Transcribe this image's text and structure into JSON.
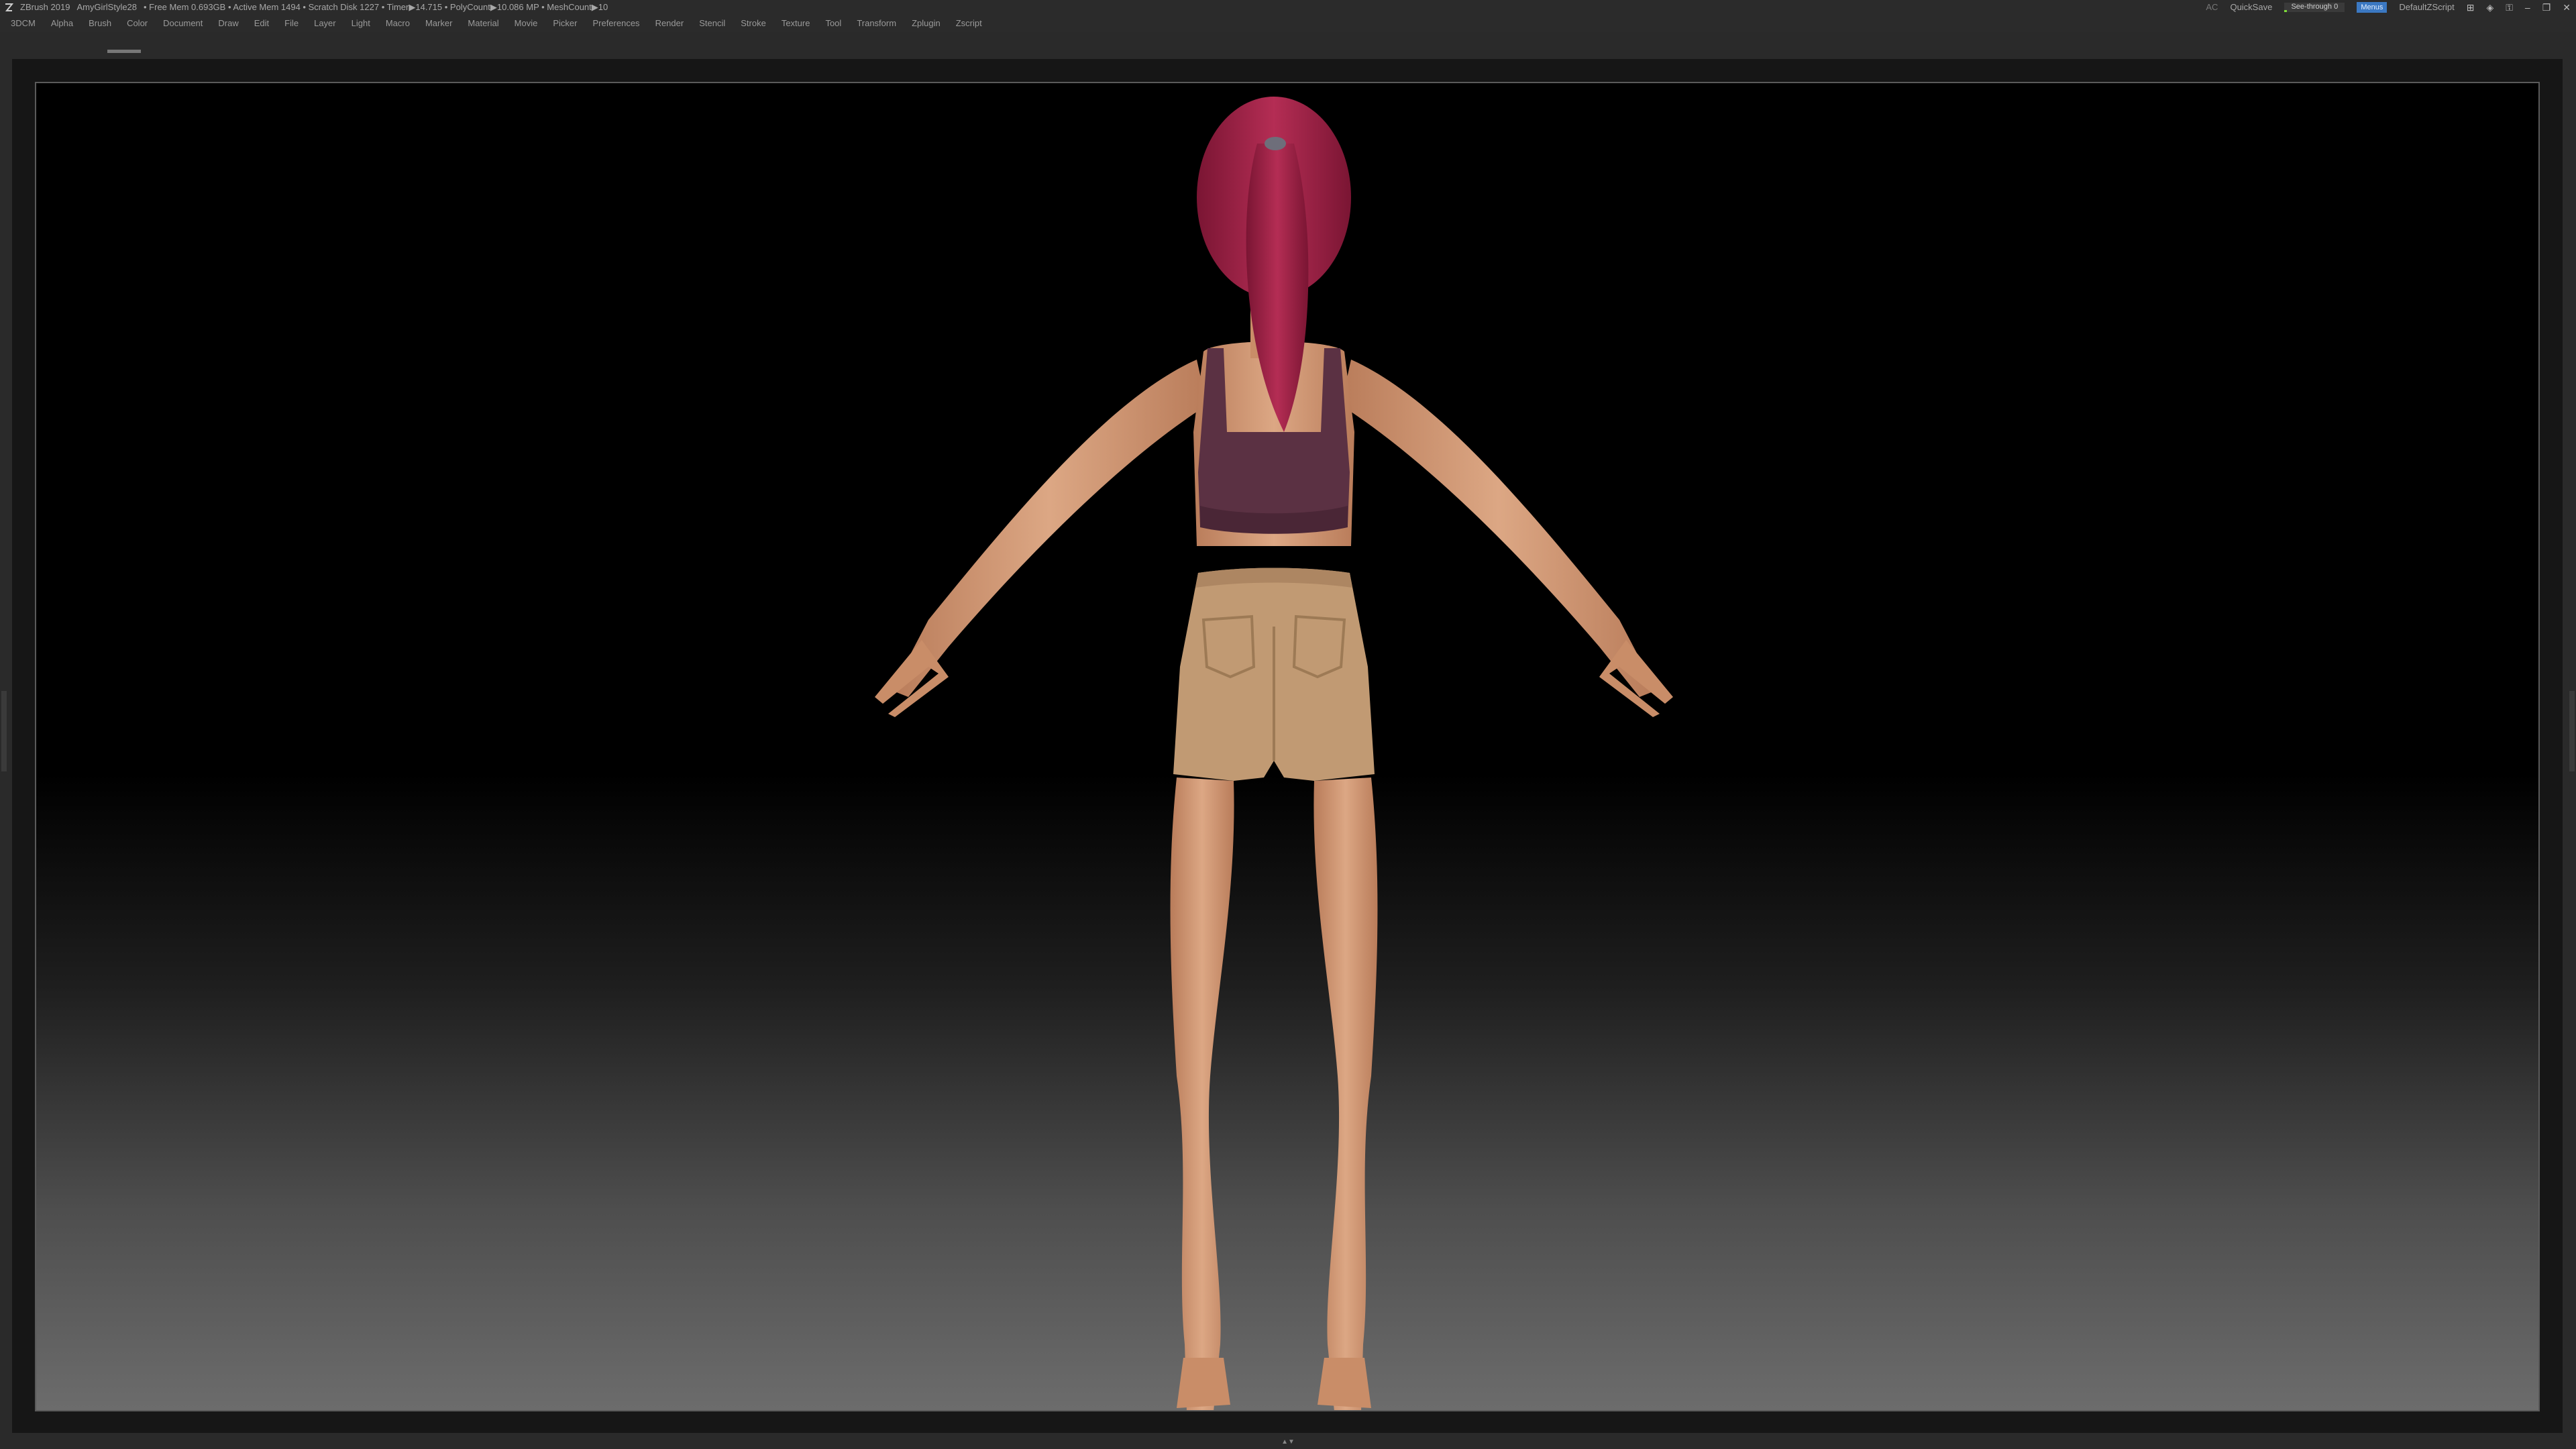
{
  "titlebar": {
    "app": "ZBrush 2019",
    "document": "AmyGirlStyle28",
    "stats": "• Free Mem 0.693GB • Active Mem 1494 • Scratch Disk 1227 • Timer▶14.715 • PolyCount▶10.086 MP  • MeshCount▶10",
    "ac": "AC",
    "quicksave": "QuickSave",
    "see_through_label": "See-through  0",
    "see_through_value": 0,
    "menus_label": "Menus",
    "script": "DefaultZScript",
    "icons": [
      "layout-icon",
      "palette-icon",
      "lock-icon",
      "minimize-icon",
      "maximize-icon",
      "close-icon"
    ]
  },
  "menubar": {
    "items": [
      "3DCM",
      "Alpha",
      "Brush",
      "Color",
      "Document",
      "Draw",
      "Edit",
      "File",
      "Layer",
      "Light",
      "Macro",
      "Marker",
      "Material",
      "Movie",
      "Picker",
      "Preferences",
      "Render",
      "Stencil",
      "Stroke",
      "Texture",
      "Tool",
      "Transform",
      "Zplugin",
      "Zscript"
    ]
  },
  "colors": {
    "skin": "#d9a07c",
    "hair": "#a8254a",
    "top": "#5b3143",
    "shorts": "#c19a73"
  }
}
